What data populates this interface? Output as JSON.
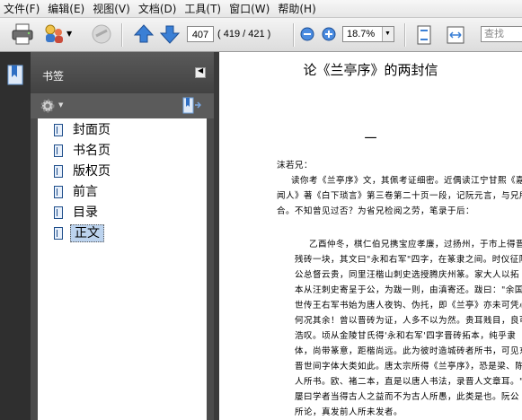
{
  "menu": [
    "文件(F)",
    "编辑(E)",
    "视图(V)",
    "文档(D)",
    "工具(T)",
    "窗口(W)",
    "帮助(H)"
  ],
  "toolbar": {
    "current_page": "407",
    "page_count": "( 419 / 421 )",
    "zoom": "18.7%",
    "search_placeholder": "查找"
  },
  "panel": {
    "title": "书签",
    "bookmarks": [
      {
        "label": "封面页"
      },
      {
        "label": "书名页"
      },
      {
        "label": "版权页"
      },
      {
        "label": "前言"
      },
      {
        "label": "目录"
      },
      {
        "label": "正文",
        "selected": true
      }
    ]
  },
  "document": {
    "title": "论《兰亭序》的两封信",
    "section_mark": "一",
    "salutation": "沫若兄：",
    "para1": [
      "读你考《兰亭序》文，其佩考证细密。近偶读江宁甘熙《嘉道",
      "闻人》著《白下琐言》第三卷第二十页一段，记阮元言，与兄所见",
      "合。不知曾见过否？为省兄检阅之劳，笔录于后："
    ],
    "quote": [
      "乙酉仲冬，棋仁伯兄携宝应孝廉，过扬州，于市上得晋",
      "残砖一块，其文曰\"永和右军\"四字，在篆隶之间。时仪征阮",
      "公总督云贵，同里汪楷山刺史选授腾庆州篆。家大人以拓",
      "本从汪刺史寄呈于公，为跋一则，由滇寄还。跋曰：\"余国嵌",
      "世传王右军书始为唐人夜钩、伪托，即《兰亭》亦未可凭心，",
      "何况其余！曾以晋砖为证，人多不以为然。贵耳贱目，良可",
      "浩叹。顷从金陵甘氏得'永和右军'四字晋砖拓本，纯乎隶",
      "体，尚带篆意，距楷尚远。此为彼时造城砖者所书，可见东",
      "晋世间字体大类如此。唐太宗所得《兰亭序》，恐是梁、陈时",
      "人所书。欧、褚二本，直是以唐人书法，录晋人文章耳。\"予",
      "屡曰学者当得古人之益而不为古人所愚，此类是也。阮公",
      "所论，真发前人所未发者。"
    ]
  }
}
